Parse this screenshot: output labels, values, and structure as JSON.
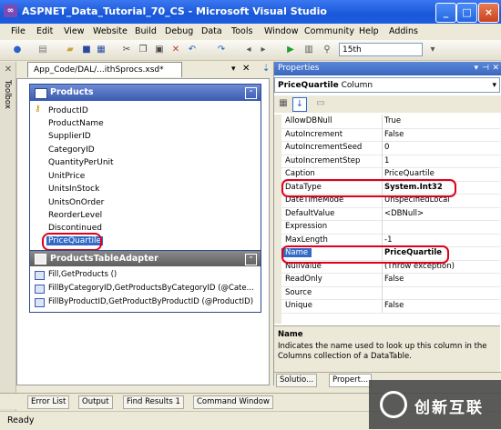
{
  "window": {
    "title": "ASPNET_Data_Tutorial_70_CS - Microsoft Visual Studio",
    "minimize": "_",
    "maximize": "□",
    "close": "×"
  },
  "menu": [
    "File",
    "Edit",
    "View",
    "Website",
    "Build",
    "Debug",
    "Data",
    "Tools",
    "Window",
    "Community",
    "Help",
    "Addins"
  ],
  "toolbar": {
    "config_value": "15th"
  },
  "toolbox": {
    "label": "Toolbox"
  },
  "designer": {
    "tab_label": "App_Code/DAL/...ithSprocs.xsd*",
    "table": {
      "name": "Products",
      "columns": [
        "ProductID",
        "ProductName",
        "SupplierID",
        "CategoryID",
        "QuantityPerUnit",
        "UnitPrice",
        "UnitsInStock",
        "UnitsOnOrder",
        "ReorderLevel",
        "Discontinued",
        "PriceQuartile"
      ],
      "selected_column": "PriceQuartile"
    },
    "adapter": {
      "name": "ProductsTableAdapter",
      "methods": [
        "Fill,GetProducts ()",
        "FillByCategoryID,GetProductsByCategoryID (@Cate...",
        "FillByProductID,GetProductByProductID (@ProductID)"
      ]
    }
  },
  "properties": {
    "header": "Properties",
    "object": "PriceQuartile",
    "object_type": "Column",
    "rows": [
      {
        "name": "AllowDBNull",
        "value": "True"
      },
      {
        "name": "AutoIncrement",
        "value": "False"
      },
      {
        "name": "AutoIncrementSeed",
        "value": "0"
      },
      {
        "name": "AutoIncrementStep",
        "value": "1"
      },
      {
        "name": "Caption",
        "value": "PriceQuartile"
      },
      {
        "name": "DataType",
        "value": "System.Int32"
      },
      {
        "name": "DateTimeMode",
        "value": "UnspecifiedLocal"
      },
      {
        "name": "DefaultValue",
        "value": "<DBNull>"
      },
      {
        "name": "Expression",
        "value": ""
      },
      {
        "name": "MaxLength",
        "value": "-1"
      },
      {
        "name": "Name",
        "value": "PriceQuartile"
      },
      {
        "name": "NullValue",
        "value": "(Throw exception)"
      },
      {
        "name": "ReadOnly",
        "value": "False"
      },
      {
        "name": "Source",
        "value": ""
      },
      {
        "name": "Unique",
        "value": "False"
      }
    ],
    "description_title": "Name",
    "description_text": "Indicates the name used to look up this column in the Columns collection of a DataTable.",
    "tabs": [
      "Solutio...",
      "Propert..."
    ]
  },
  "lower_tabs": [
    "Error List",
    "Output",
    "Find Results 1",
    "Command Window"
  ],
  "status": "Ready",
  "watermark": "创新互联"
}
